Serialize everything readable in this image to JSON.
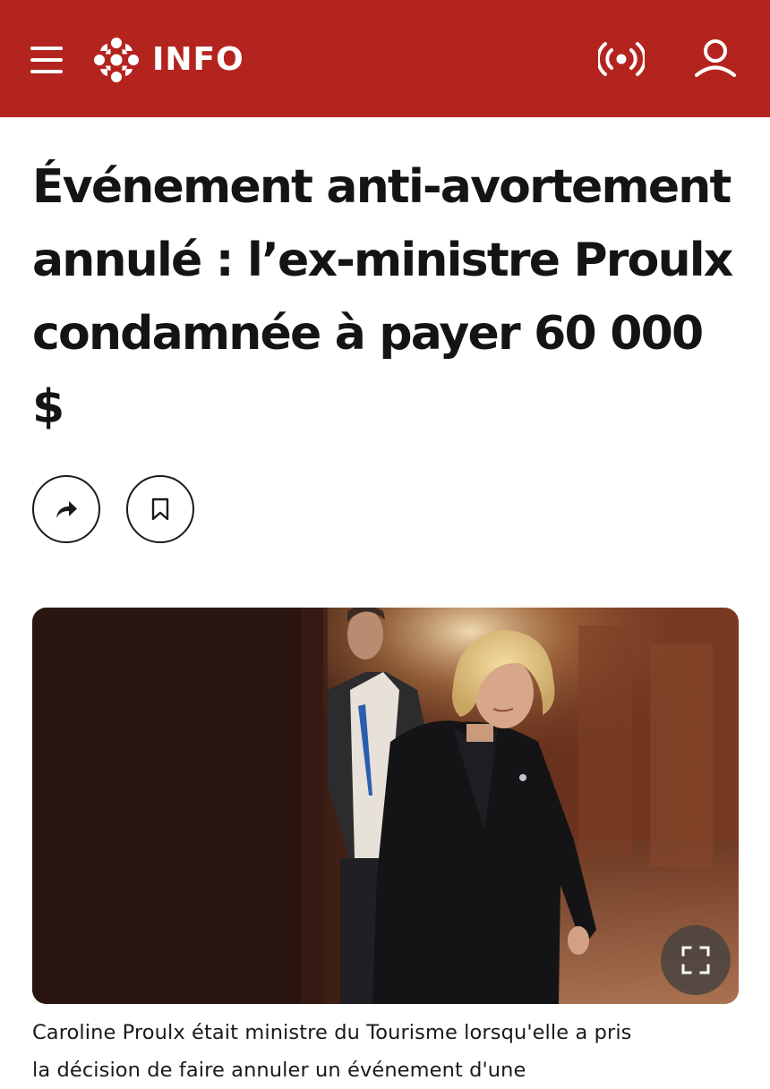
{
  "header": {
    "menu_icon": "hamburger-menu-icon",
    "logo_icon": "radio-canada-gem-icon",
    "logo_text": "INFO",
    "live_icon": "broadcast-icon",
    "user_icon": "user-profile-icon",
    "background_color": "#b4241e"
  },
  "article": {
    "headline": "Événement anti-avortement annulé : l’ex-ministre Proulx condamnée à payer 60 000 $",
    "actions": {
      "share_icon": "share-arrow-icon",
      "bookmark_icon": "bookmark-icon"
    },
    "photo": {
      "description_icon": "photo",
      "fullscreen_icon": "fullscreen-icon"
    },
    "caption": "Caroline Proulx était ministre du Tourisme lorsqu'elle a pris la décision de faire annuler un événement d'une"
  }
}
